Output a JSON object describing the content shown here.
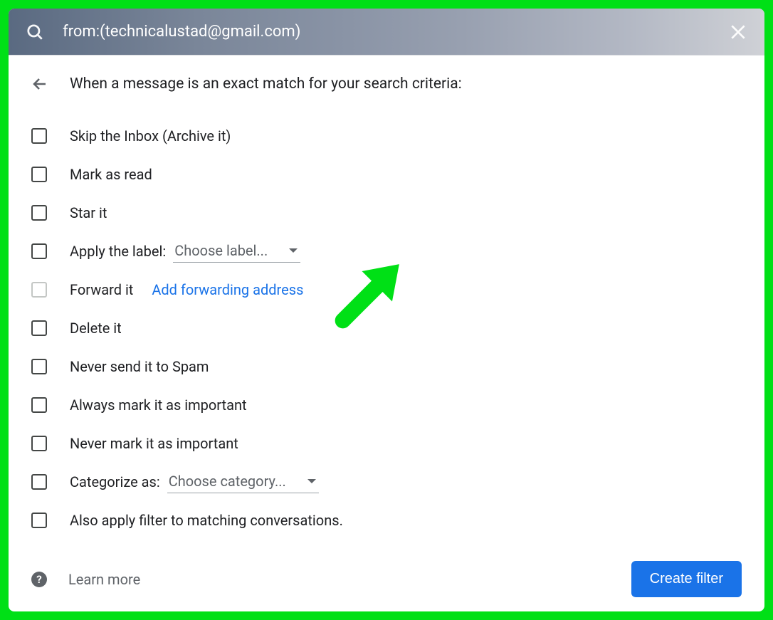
{
  "search": {
    "query": "from:(technicalustad@gmail.com)"
  },
  "header": {
    "title": "When a message is an exact match for your search criteria:"
  },
  "options": {
    "skip_inbox": "Skip the Inbox (Archive it)",
    "mark_read": "Mark as read",
    "star": "Star it",
    "apply_label_prefix": "Apply the label:",
    "apply_label_dropdown": "Choose label...",
    "forward": "Forward it",
    "forward_link": "Add forwarding address",
    "delete": "Delete it",
    "never_spam": "Never send it to Spam",
    "always_important": "Always mark it as important",
    "never_important": "Never mark it as important",
    "categorize_prefix": "Categorize as:",
    "categorize_dropdown": "Choose category...",
    "also_apply": "Also apply filter to matching conversations."
  },
  "footer": {
    "learn_more": "Learn more",
    "create": "Create filter"
  }
}
